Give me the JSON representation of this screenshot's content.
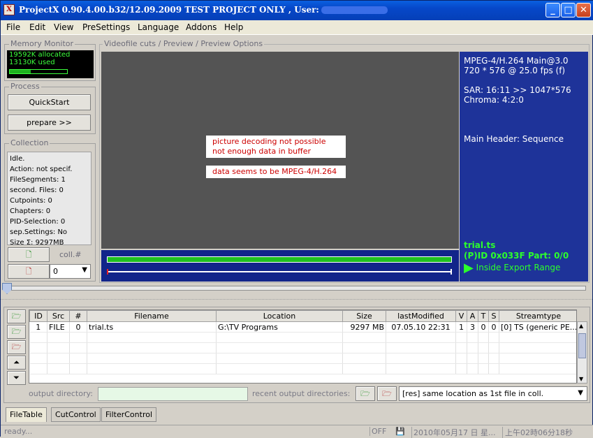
{
  "window": {
    "title": "ProjectX 0.90.4.00.b32/12.09.2009 TEST PROJECT ONLY , User:"
  },
  "menu": [
    "File",
    "Edit",
    "View",
    "PreSettings",
    "Language",
    "Addons",
    "Help"
  ],
  "memory": {
    "title": "Memory Monitor",
    "allocated": "19592K allocated",
    "used": "13130K used",
    "usage_fraction": 0.36
  },
  "process": {
    "title": "Process",
    "quickstart": "QuickStart",
    "prepare": "prepare >>"
  },
  "collection": {
    "title": "Collection",
    "lines": [
      "Idle.",
      "Action: not specif.",
      "FileSegments: 1",
      "second. Files: 0",
      "Cutpoints: 0",
      "Chapters: 0",
      "PID-Selection: 0",
      "sep.Settings: No",
      "Size Σ: 9297MB"
    ],
    "coll_label": "coll.#",
    "coll_value": "0"
  },
  "preview": {
    "title": "Videofile cuts / Preview / Preview Options",
    "msg1a": "picture decoding not possible",
    "msg1b": "not enough data in buffer",
    "msg2": "data seems to be MPEG-4/H.264"
  },
  "info": {
    "codec": "MPEG-4/H.264  Main@3.0",
    "resolution": "720 * 576 @ 25.0 fps (f)",
    "sar": "SAR: 16:11 >> 1047*576",
    "chroma": "Chroma:  4:2:0",
    "header": "Main Header: Sequence",
    "file": "trial.ts",
    "pid": "(P)ID 0x033F   Part: 0/0",
    "range": "Inside Export Range"
  },
  "table": {
    "columns": [
      "ID",
      "Src",
      "#",
      "Filename",
      "Location",
      "Size",
      "lastModified",
      "V",
      "A",
      "T",
      "S",
      "Streamtype"
    ],
    "rows": [
      [
        "1",
        "FILE",
        "0",
        "trial.ts",
        "G:\\TV Programs",
        "9297 MB",
        "07.05.10  22:31",
        "1",
        "3",
        "0",
        "0",
        "[0] TS (generic PE..."
      ]
    ]
  },
  "output": {
    "label": "output directory:",
    "recent_label": "recent output directories:",
    "recent_value": "[res] same location as 1st file in coll."
  },
  "tabs": [
    "FileTable",
    "CutControl",
    "FilterControl"
  ],
  "status": {
    "text": "ready...",
    "off": "OFF",
    "date": "2010年05月17 日 星...",
    "time": "上午02時06分18秒"
  },
  "colors": {
    "preview_bg": "#545454",
    "info_bg": "#1e3399",
    "accent_green": "#2cff2c",
    "message_red": "#cc0000"
  }
}
